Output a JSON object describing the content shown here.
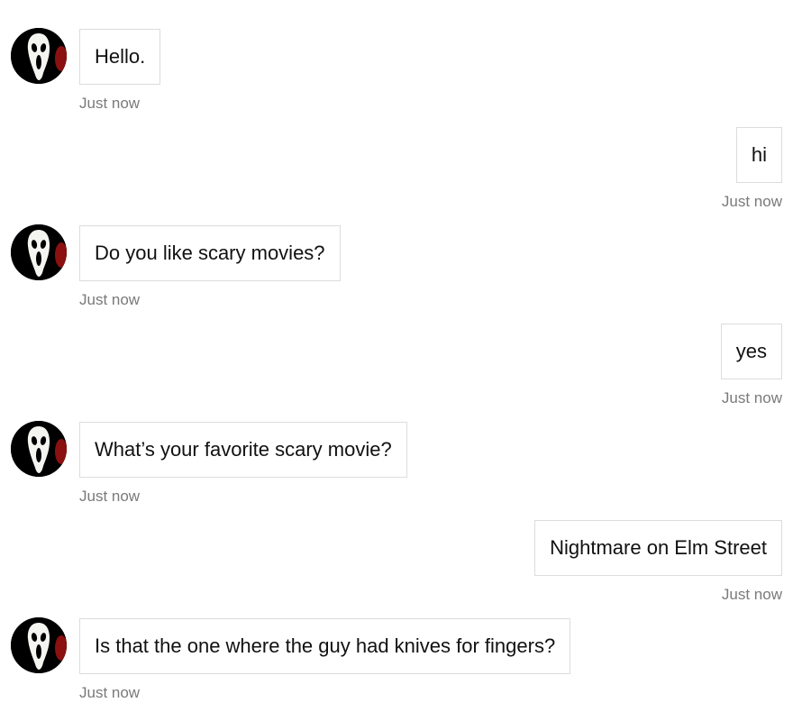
{
  "messages": [
    {
      "sender": "bot",
      "text": "Hello.",
      "time": "Just now",
      "avatar_icon": "ghostface-mask-icon"
    },
    {
      "sender": "user",
      "text": "hi",
      "time": "Just now"
    },
    {
      "sender": "bot",
      "text": "Do you like scary movies?",
      "time": "Just now",
      "avatar_icon": "ghostface-mask-icon"
    },
    {
      "sender": "user",
      "text": "yes",
      "time": "Just now"
    },
    {
      "sender": "bot",
      "text": "What’s your favorite scary movie?",
      "time": "Just now",
      "avatar_icon": "ghostface-mask-icon"
    },
    {
      "sender": "user",
      "text": "Nightmare on Elm Street",
      "time": "Just now"
    },
    {
      "sender": "bot",
      "text": "Is that the one where the guy had knives for fingers?",
      "time": "Just now",
      "avatar_icon": "ghostface-mask-icon"
    }
  ],
  "colors": {
    "bubble_border": "#dcdcdc",
    "timestamp": "#7a7a7a",
    "avatar_bg": "#000000",
    "avatar_accent": "#8b1010"
  }
}
